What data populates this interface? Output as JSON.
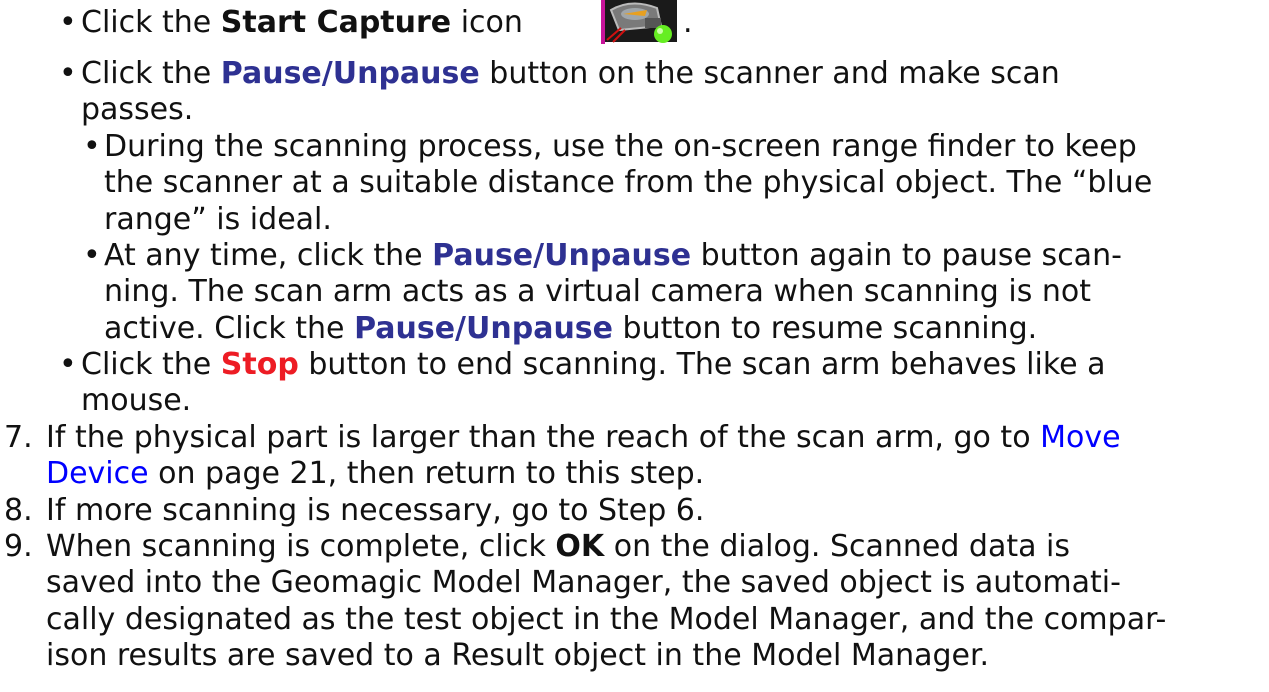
{
  "bullets": {
    "symbol": "•",
    "start_capture": {
      "pre": "Click the ",
      "strong": "Start Capture",
      "post": " icon",
      "end": ".",
      "icon": "start-capture-icon"
    },
    "pause": {
      "pre": "Click the ",
      "strong": "Pause/Unpause",
      "post_line1": " button on the scanner and make scan",
      "line2": "passes."
    },
    "range_finder": {
      "line1": "During the scanning process, use the on-screen range finder to keep",
      "line2": "the scanner at a suitable distance from the physical object. The “blue",
      "line3": "range” is ideal."
    },
    "pause_again": {
      "pre": "At any time, click the ",
      "strong1": "Pause/Unpause",
      "post1": " button again to pause scan-",
      "line2": "ning. The scan arm acts as a virtual camera when scanning is not",
      "line3_pre": "active. Click the ",
      "strong2": "Pause/Unpause",
      "line3_post": " button to resume scanning."
    },
    "stop": {
      "pre": "Click the ",
      "strong": "Stop",
      "post": " button to end scanning. The scan arm behaves like a",
      "line2": "mouse."
    }
  },
  "steps": {
    "step7": {
      "num": "7.",
      "pre": "If the physical part is larger than the reach of the scan arm, go to ",
      "link1": "Move",
      "link2": "Device",
      "post": " on page 21, then return to this step."
    },
    "step8": {
      "num": "8.",
      "text": "If more scanning is necessary, go to Step 6."
    },
    "step9": {
      "num": "9.",
      "pre": "When scanning is complete, click ",
      "strong": "OK",
      "post": " on the dialog. Scanned data is",
      "line2": "saved into the Geomagic Model Manager, the saved object is automati-",
      "line3": "cally designated as the test object in the Model Manager, and the compar-",
      "line4": "ison results are saved to a Result object in the Model Manager."
    }
  },
  "colors": {
    "ui_term": "#2e3192",
    "stop_term": "#ed1c24",
    "link": "#0000ff"
  }
}
